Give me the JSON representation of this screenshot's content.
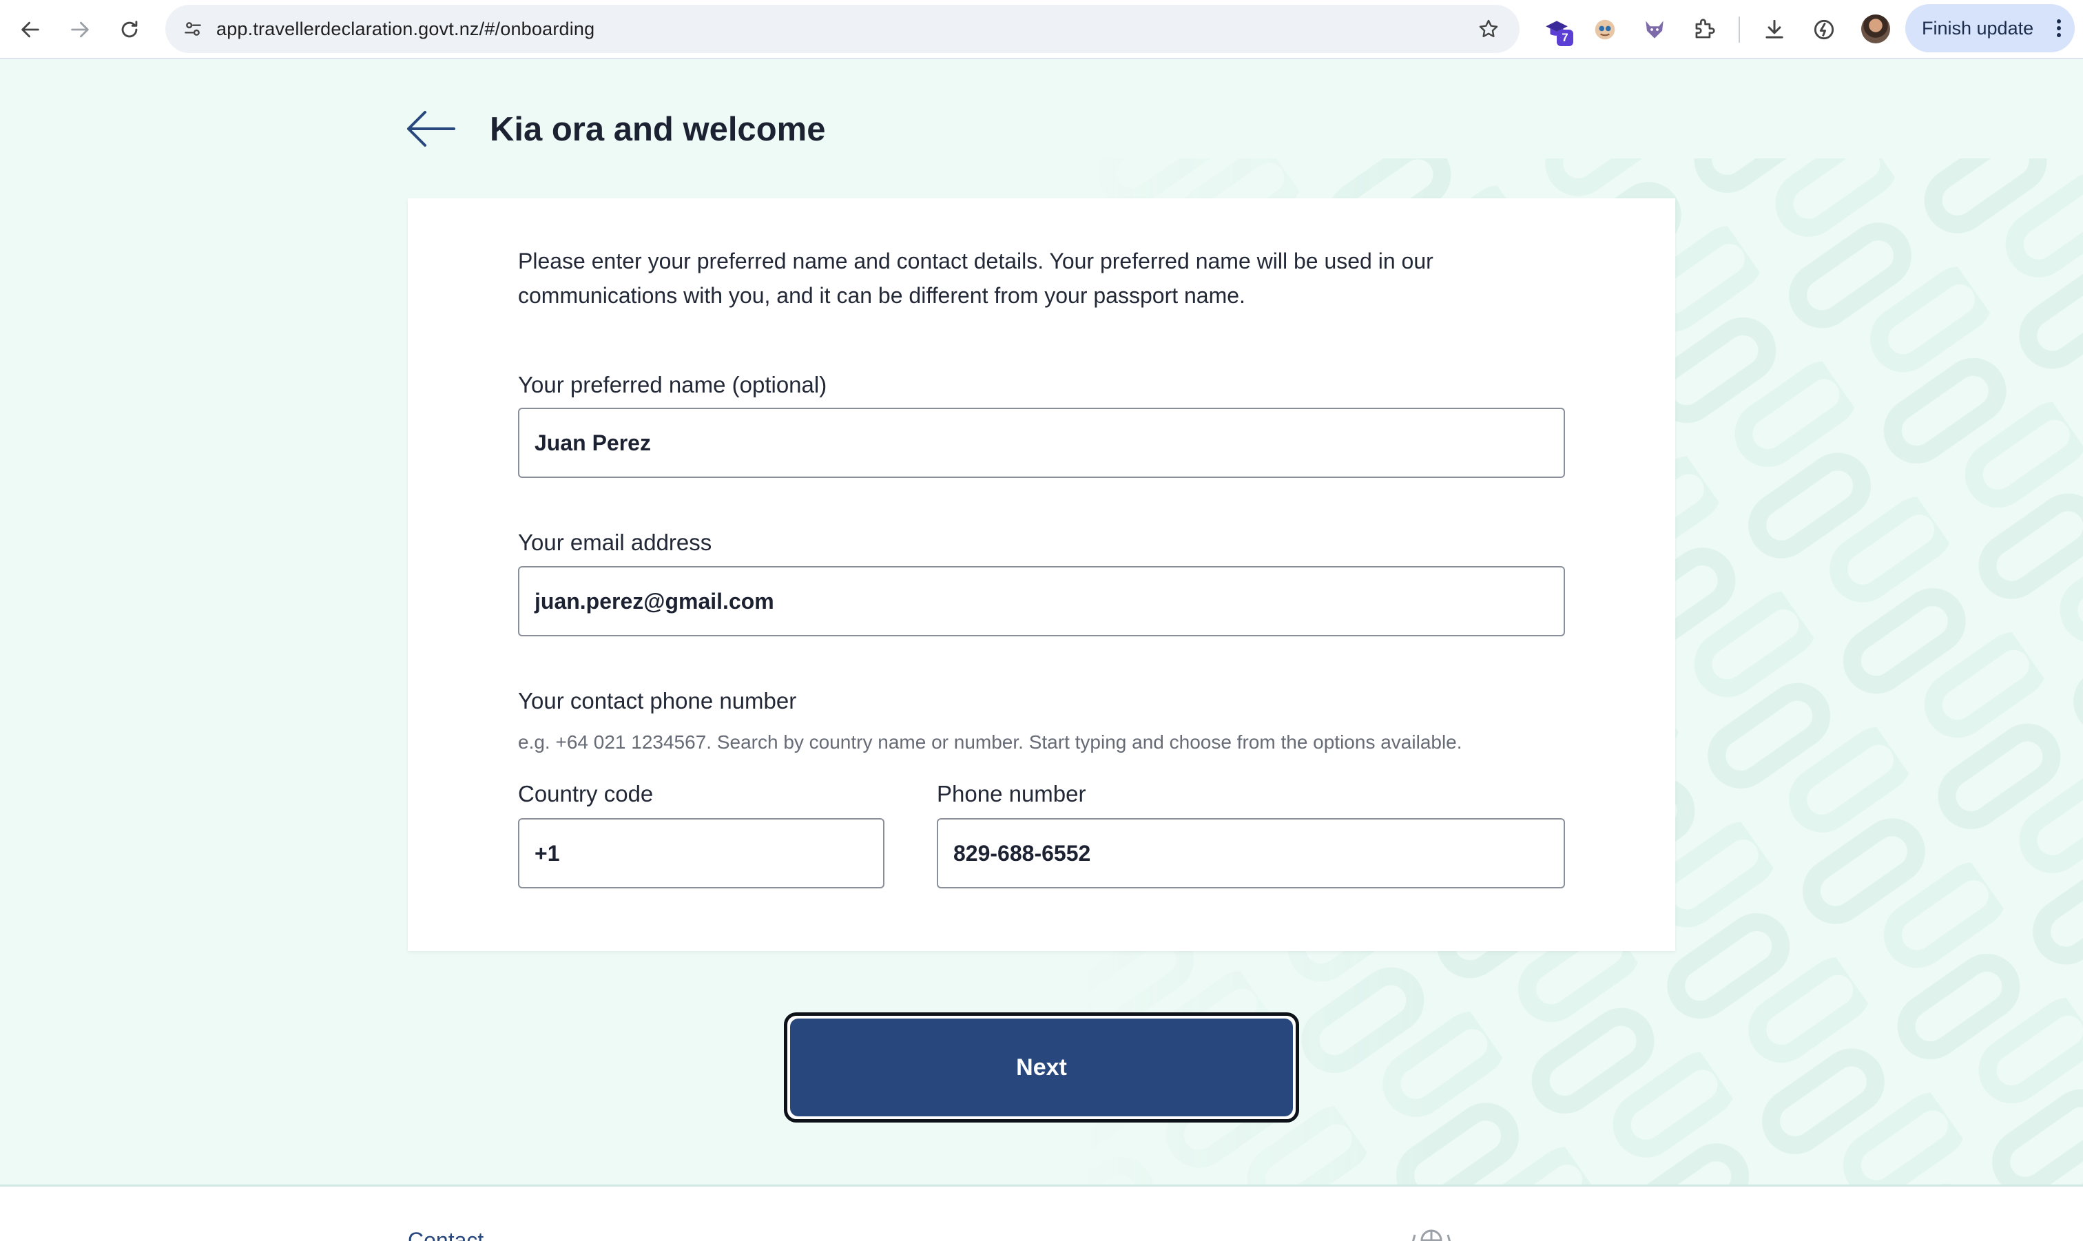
{
  "browser": {
    "url": "app.travellerdeclaration.govt.nz/#/onboarding",
    "extension_badge": "7",
    "finish_update_label": "Finish update"
  },
  "page": {
    "title": "Kia ora and welcome",
    "intro": "Please enter your preferred name and contact details. Your preferred name will be used in our communications with you, and it can be different from your passport name.",
    "preferred_name": {
      "label": "Your preferred name (optional)",
      "value": "Juan Perez"
    },
    "email": {
      "label": "Your email address",
      "value": "juan.perez@gmail.com"
    },
    "phone": {
      "label": "Your contact phone number",
      "hint": "e.g. +64 021 1234567. Search by country name or number. Start typing and choose from the options available.",
      "country_code_label": "Country code",
      "country_code_value": "+1",
      "number_label": "Phone number",
      "number_value": "829-688-6552"
    },
    "next_label": "Next"
  },
  "footer": {
    "link_label": "Contact"
  },
  "colors": {
    "page_bg": "#eefaf6",
    "primary_button": "#28487d",
    "title_text": "#1d2233"
  }
}
